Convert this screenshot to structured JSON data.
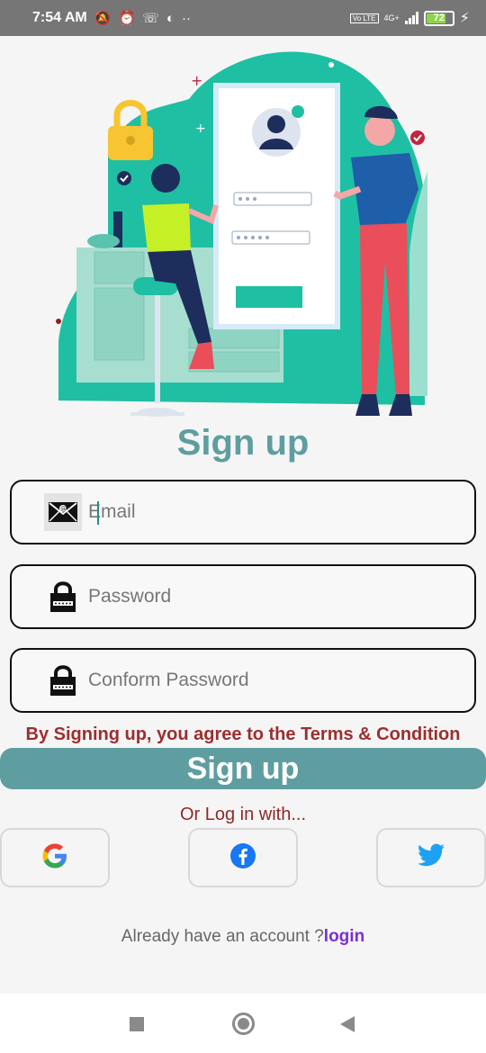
{
  "status_bar": {
    "time": "7:54 AM",
    "icons": [
      "notifications-off-icon",
      "alarm-icon",
      "missed-call-icon",
      "app-icon",
      "more-dots-icon"
    ],
    "volte_label": "Vo LTE",
    "network_label": "4G+",
    "battery_level": "72"
  },
  "title": "Sign up",
  "fields": {
    "email_placeholder": "Email",
    "password_placeholder": "Password",
    "confirm_placeholder": "Conform Password"
  },
  "terms_text": "By Signing up, you agree to the Terms & Condition",
  "signup_button": "Sign up",
  "or_text": "Or Log in with...",
  "social": [
    "google-icon",
    "facebook-icon",
    "twitter-icon"
  ],
  "footer": {
    "prompt": "Already have an account ?",
    "login_label": "login"
  },
  "colors": {
    "accent": "#5f9ea0",
    "teal_illustration": "#1fbfa3",
    "terms": "#9b2f2f",
    "login": "#7b2fd6"
  }
}
